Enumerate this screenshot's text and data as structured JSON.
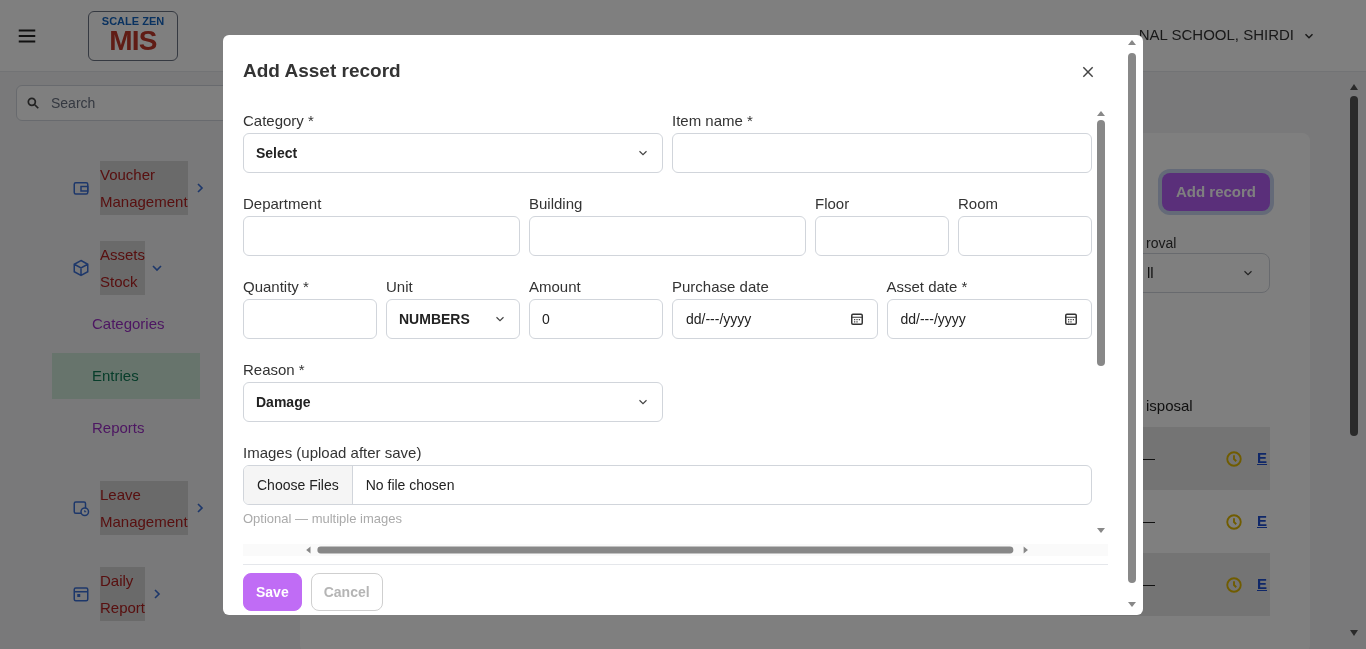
{
  "header": {
    "logo": {
      "top": "SCALE ZEN",
      "bottom": "MIS"
    },
    "school": "NAL SCHOOL, SHIRDI"
  },
  "sidebar": {
    "search": {
      "placeholder": "Search"
    },
    "items": [
      {
        "label": "Voucher Management",
        "expanded": false
      },
      {
        "label": "Assets Stock",
        "expanded": true,
        "children": [
          {
            "label": "Categories",
            "selected": false
          },
          {
            "label": "Entries",
            "selected": true
          },
          {
            "label": "Reports",
            "selected": false
          }
        ]
      },
      {
        "label": "Leave Management",
        "expanded": false
      },
      {
        "label": "Daily Report",
        "expanded": false
      }
    ]
  },
  "main": {
    "add_button": "Add record",
    "filter": {
      "label": "roval",
      "value": "ll"
    },
    "table": {
      "columns": [
        "isposal"
      ],
      "rows": [
        {
          "disposal": "—",
          "link": "E"
        },
        {
          "disposal": "—",
          "link": "E"
        },
        {
          "disposal": "—",
          "link": "E"
        }
      ]
    }
  },
  "modal": {
    "title": "Add Asset record",
    "fields": [
      {
        "label": "Category *",
        "kind": "select",
        "value": "Select"
      },
      {
        "label": "Item name *",
        "kind": "text"
      },
      {
        "label": "Department",
        "kind": "text"
      },
      {
        "label": "Building",
        "kind": "text"
      },
      {
        "label": "Floor",
        "kind": "text"
      },
      {
        "label": "Room",
        "kind": "text"
      },
      {
        "label": "Quantity *",
        "kind": "text"
      },
      {
        "label": "Unit",
        "kind": "select",
        "value": "NUMBERS"
      },
      {
        "label": "Amount",
        "kind": "text",
        "value": "0"
      },
      {
        "label": "Purchase date",
        "kind": "date",
        "value": "dd/---/yyyy"
      },
      {
        "label": "Asset date *",
        "kind": "date",
        "value": "dd/---/yyyy"
      },
      {
        "label": "Reason *",
        "kind": "select",
        "value": "Damage"
      },
      {
        "label": "Images (upload after save)",
        "kind": "file",
        "button": "Choose Files",
        "value": "No file chosen",
        "hint": "Optional — multiple images"
      }
    ],
    "buttons": [
      {
        "label": "Save",
        "kind": "primary"
      },
      {
        "label": "Cancel",
        "kind": "secondary"
      }
    ]
  }
}
